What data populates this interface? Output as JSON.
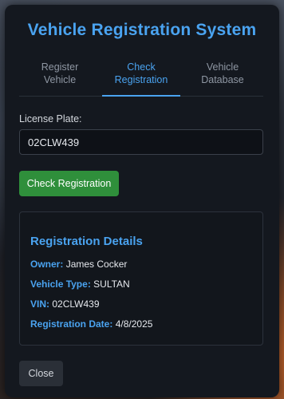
{
  "app": {
    "title": "Vehicle Registration System"
  },
  "tabs": [
    {
      "label": "Register\nVehicle",
      "active": false
    },
    {
      "label": "Check\nRegistration",
      "active": true
    },
    {
      "label": "Vehicle\nDatabase",
      "active": false
    }
  ],
  "form": {
    "plate_label": "License Plate:",
    "plate_value": "02CLW439",
    "check_button": "Check Registration"
  },
  "details": {
    "heading": "Registration Details",
    "owner_label": "Owner:",
    "owner": "James Cocker",
    "type_label": "Vehicle Type:",
    "type": "SULTAN",
    "vin_label": "VIN:",
    "vin": "02CLW439",
    "date_label": "Registration Date:",
    "date": "4/8/2025"
  },
  "footer": {
    "close_button": "Close"
  },
  "colors": {
    "accent": "#4aa3f0",
    "success": "#2f8f3b",
    "panel": "#14181f"
  }
}
